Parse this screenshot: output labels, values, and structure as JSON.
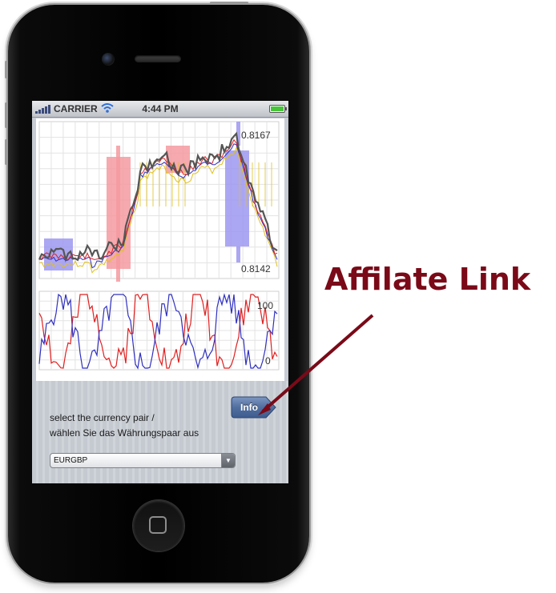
{
  "status_bar": {
    "carrier": "CARRIER",
    "time": "4:44 PM"
  },
  "chart": {
    "price_high_label": "0.8167",
    "price_low_label": "0.8142",
    "osc_high_label": "100",
    "osc_low_label": "0"
  },
  "panel": {
    "info_label": "Info",
    "prompt_line1": "select the currency pair /",
    "prompt_line2": "wählen Sie das Währungspaar aus",
    "currency_select": {
      "selected": "EURGBP"
    }
  },
  "annotation": {
    "text": "Affilate Link",
    "color": "#7a0a18"
  },
  "icons": {
    "signal": "signal-bars-icon",
    "wifi": "wifi-icon",
    "battery": "battery-icon",
    "home": "home-button-icon",
    "dropdown": "chevron-down-icon"
  },
  "colors": {
    "bullish_box": "#f59aa0",
    "bearish_box": "#9d98f0",
    "price_line": "#555555",
    "fast_line": "#e02020",
    "slow_line": "#3030c0",
    "cloud_line": "#e0c020",
    "info_button": "#4f6d9c"
  }
}
